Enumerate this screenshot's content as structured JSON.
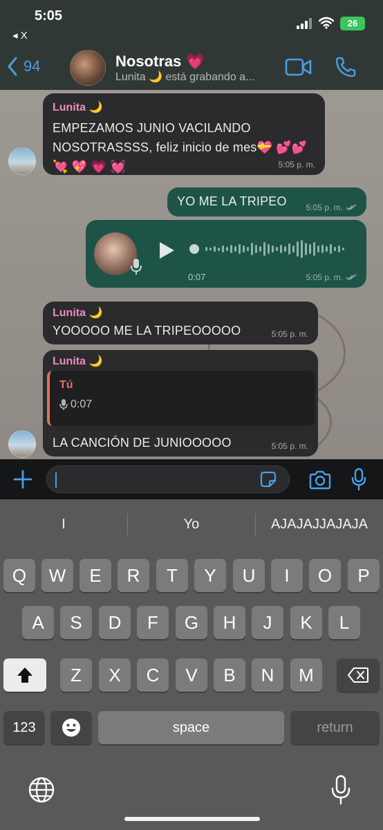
{
  "status_bar": {
    "time": "5:05",
    "back_app": "◂ X",
    "battery": "26"
  },
  "header": {
    "back_count": "94",
    "chat_name": "Nosotras 💗",
    "chat_status": "Lunita 🌙 está grabando a..."
  },
  "messages": {
    "m1": {
      "sender": "Lunita 🌙",
      "text": "EMPEZAMOS JUNIO VACILANDO NOSOTRASSSS, feliz inicio de mes💝 💕💕 💘 💖 💗 💓",
      "time": "5:05 p. m."
    },
    "m2": {
      "text": "YO ME LA TRIPEO",
      "time": "5:05 p. m."
    },
    "m3": {
      "duration": "0:07",
      "time": "5:05 p. m."
    },
    "m4": {
      "sender": "Lunita 🌙",
      "text": "YOOOOO ME LA TRIPEOOOOO",
      "time": "5:05 p. m."
    },
    "m5": {
      "sender": "Lunita 🌙",
      "quote_name": "Tú",
      "quote_body": "0:07",
      "text": "LA CANCIÓN DE JUNIOOOOO",
      "time": "5:05 p. m."
    }
  },
  "keyboard": {
    "suggestions": [
      "I",
      "Yo",
      "AJAJAJJAJAJA"
    ],
    "row1": [
      "Q",
      "W",
      "E",
      "R",
      "T",
      "Y",
      "U",
      "I",
      "O",
      "P"
    ],
    "row2": [
      "A",
      "S",
      "D",
      "F",
      "G",
      "H",
      "J",
      "K",
      "L"
    ],
    "row3": [
      "Z",
      "X",
      "C",
      "V",
      "B",
      "N",
      "M"
    ],
    "num_key": "123",
    "space_key": "space",
    "return_key": "return"
  }
}
